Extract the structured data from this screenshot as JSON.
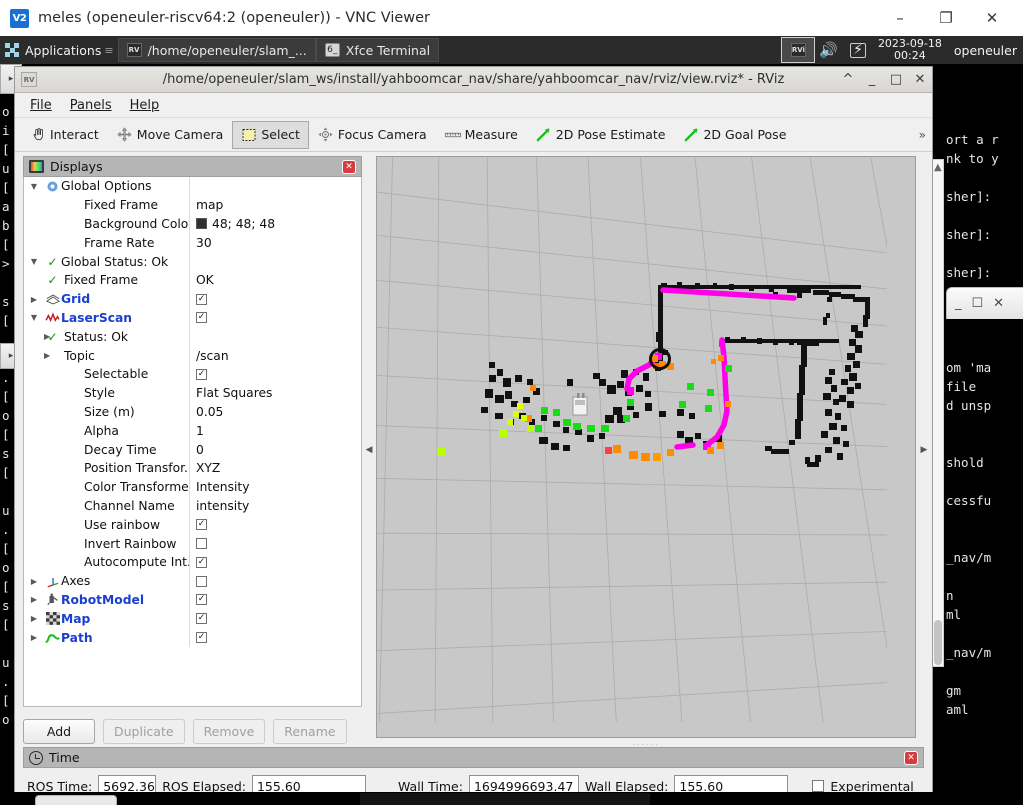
{
  "vnc": {
    "logo": "V2",
    "title": "meles (openeuler-riscv64:2 (openeuler)) - VNC Viewer",
    "minimize": "–",
    "maximize": "❐",
    "close": "✕"
  },
  "taskbar": {
    "applications_label": "Applications",
    "handle": "≡",
    "tasks": [
      {
        "icon": "rviz-icon",
        "label": "/home/openeuler/slam_..."
      },
      {
        "icon": "terminal-icon",
        "label": "Xfce Terminal"
      }
    ],
    "tray_window_icon": "RVi",
    "volume_icon": "volume-icon",
    "battery_icon": "battery-icon",
    "date": "2023-09-18",
    "time": "00:24",
    "user": "openeuler"
  },
  "terminals": {
    "left_text": ">\n\no\ni\n[\nu\n[\na\nb\n[\n>\n\ns\n[\n\nu\n.\n[\no\n[\ns\n[\n\nu\n.\n[\no\n[\ns\n[\n\nu\n.\n[\no",
    "right_text": "ort a r\nnk to y\n\nsher]:\n\nsher]:\n\nsher]:\n\n\n\n\nom 'ma\nfile\nd unsp\n\n\nshold\n\ncessfu\n\n\n_nav/m\n\nn\nml\n\n_nav/m\n\ngm\naml"
  },
  "rviz": {
    "window_icon": "rviz-icon",
    "title": "/home/openeuler/slam_ws/install/yahboomcar_nav/share/yahboomcar_nav/rviz/view.rviz* - RViz",
    "window_buttons": {
      "shade": "^",
      "minimize": "_",
      "maximize": "□",
      "close": "✕"
    },
    "menu": [
      "File",
      "Panels",
      "Help"
    ],
    "toolbar": {
      "items": [
        {
          "label": "Interact",
          "icon": "hand-cursor-icon",
          "active": false
        },
        {
          "label": "Move Camera",
          "icon": "move-camera-icon",
          "active": false
        },
        {
          "label": "Select",
          "icon": "select-rect-icon",
          "active": true
        },
        {
          "label": "Focus Camera",
          "icon": "focus-camera-icon",
          "active": false
        },
        {
          "label": "Measure",
          "icon": "ruler-icon",
          "active": false
        },
        {
          "label": "2D Pose Estimate",
          "icon": "pose-arrow-icon",
          "active": false
        },
        {
          "label": "2D Goal Pose",
          "icon": "goal-arrow-icon",
          "active": false
        }
      ],
      "overflow": "»"
    },
    "displays": {
      "panel_title": "Displays",
      "close_glyph": "✕",
      "rows": [
        {
          "id": "global-options",
          "arrow": "down",
          "icon": "gear-icon",
          "label": "Global Options",
          "label_style": "plain",
          "indent": 0,
          "value_type": "none",
          "value": ""
        },
        {
          "id": "fixed-frame",
          "arrow": "",
          "icon": "",
          "label": "Fixed Frame",
          "label_style": "plain",
          "indent": 1,
          "value_type": "text",
          "value": "map"
        },
        {
          "id": "background-color",
          "arrow": "",
          "icon": "",
          "label": "Background Color",
          "label_style": "plain",
          "indent": 1,
          "value_type": "color",
          "value": "48; 48; 48",
          "color": "#303030"
        },
        {
          "id": "frame-rate",
          "arrow": "",
          "icon": "",
          "label": "Frame Rate",
          "label_style": "plain",
          "indent": 1,
          "value_type": "text",
          "value": "30"
        },
        {
          "id": "global-status",
          "arrow": "down",
          "icon": "check-icon",
          "label": "Global Status: Ok",
          "label_style": "plain",
          "indent": 0,
          "value_type": "none",
          "value": ""
        },
        {
          "id": "status-fixed-frame",
          "arrow": "",
          "icon": "check-icon",
          "label": "Fixed Frame",
          "label_style": "plain",
          "indent": 1,
          "value_type": "text",
          "value": "OK"
        },
        {
          "id": "grid",
          "arrow": "right",
          "icon": "grid-icon",
          "label": "Grid",
          "label_style": "blue",
          "indent": 0,
          "value_type": "checkbox",
          "value": "checked"
        },
        {
          "id": "laserscan",
          "arrow": "down",
          "icon": "laserscan-icon",
          "label": "LaserScan",
          "label_style": "blue",
          "indent": 0,
          "value_type": "checkbox",
          "value": "checked"
        },
        {
          "id": "laserscan-status",
          "arrow": "right-ind",
          "icon": "check-icon",
          "label": "Status: Ok",
          "label_style": "plain",
          "indent": 1,
          "value_type": "none",
          "value": ""
        },
        {
          "id": "laserscan-topic",
          "arrow": "right-ind",
          "icon": "",
          "label": "Topic",
          "label_style": "plain",
          "indent": 1,
          "value_type": "text",
          "value": "/scan"
        },
        {
          "id": "laserscan-selectable",
          "arrow": "",
          "icon": "",
          "label": "Selectable",
          "label_style": "plain",
          "indent": 1,
          "value_type": "checkbox",
          "value": "checked"
        },
        {
          "id": "laserscan-style",
          "arrow": "",
          "icon": "",
          "label": "Style",
          "label_style": "plain",
          "indent": 1,
          "value_type": "text",
          "value": "Flat Squares"
        },
        {
          "id": "laserscan-size",
          "arrow": "",
          "icon": "",
          "label": "Size (m)",
          "label_style": "plain",
          "indent": 1,
          "value_type": "text",
          "value": "0.05"
        },
        {
          "id": "laserscan-alpha",
          "arrow": "",
          "icon": "",
          "label": "Alpha",
          "label_style": "plain",
          "indent": 1,
          "value_type": "text",
          "value": "1"
        },
        {
          "id": "laserscan-decay-time",
          "arrow": "",
          "icon": "",
          "label": "Decay Time",
          "label_style": "plain",
          "indent": 1,
          "value_type": "text",
          "value": "0"
        },
        {
          "id": "laserscan-position-transformer",
          "arrow": "",
          "icon": "",
          "label": "Position Transfor...",
          "label_style": "plain",
          "indent": 1,
          "value_type": "text",
          "value": "XYZ"
        },
        {
          "id": "laserscan-color-transformer",
          "arrow": "",
          "icon": "",
          "label": "Color Transformer",
          "label_style": "plain",
          "indent": 1,
          "value_type": "text",
          "value": "Intensity"
        },
        {
          "id": "laserscan-channel-name",
          "arrow": "",
          "icon": "",
          "label": "Channel Name",
          "label_style": "plain",
          "indent": 1,
          "value_type": "text",
          "value": "intensity"
        },
        {
          "id": "laserscan-use-rainbow",
          "arrow": "",
          "icon": "",
          "label": "Use rainbow",
          "label_style": "plain",
          "indent": 1,
          "value_type": "checkbox",
          "value": "checked"
        },
        {
          "id": "laserscan-invert-rainbow",
          "arrow": "",
          "icon": "",
          "label": "Invert Rainbow",
          "label_style": "plain",
          "indent": 1,
          "value_type": "checkbox",
          "value": "unchecked"
        },
        {
          "id": "laserscan-autocompute-intensity",
          "arrow": "",
          "icon": "",
          "label": "Autocompute Int...",
          "label_style": "plain",
          "indent": 1,
          "value_type": "checkbox",
          "value": "checked"
        },
        {
          "id": "axes",
          "arrow": "right",
          "icon": "axes-icon",
          "label": "Axes",
          "label_style": "plain",
          "indent": 0,
          "value_type": "checkbox",
          "value": "unchecked"
        },
        {
          "id": "robotmodel",
          "arrow": "right",
          "icon": "robot-icon",
          "label": "RobotModel",
          "label_style": "blue",
          "indent": 0,
          "value_type": "checkbox",
          "value": "checked"
        },
        {
          "id": "map",
          "arrow": "right",
          "icon": "map-icon",
          "label": "Map",
          "label_style": "blue",
          "indent": 0,
          "value_type": "checkbox",
          "value": "checked"
        },
        {
          "id": "path",
          "arrow": "right",
          "icon": "path-icon",
          "label": "Path",
          "label_style": "blue",
          "indent": 0,
          "value_type": "checkbox",
          "value": "checked"
        }
      ],
      "buttons": [
        {
          "label": "Add",
          "disabled": false
        },
        {
          "label": "Duplicate",
          "disabled": true
        },
        {
          "label": "Remove",
          "disabled": true
        },
        {
          "label": "Rename",
          "disabled": true
        }
      ]
    },
    "time_panel": {
      "panel_title": "Time",
      "close_glyph": "✕",
      "ros_time_label": "ROS Time:",
      "ros_time_value": "5692.36",
      "ros_elapsed_label": "ROS Elapsed:",
      "ros_elapsed_value": "155.60",
      "wall_time_label": "Wall Time:",
      "wall_time_value": "1694996693.47",
      "wall_elapsed_label": "Wall Elapsed:",
      "wall_elapsed_value": "155.60",
      "experimental_label": "Experimental",
      "experimental_checked": false
    },
    "render_view": {
      "background_color": "#c8c8c8",
      "grid_color": "#a8a8a8",
      "occupancy_color": "#000000",
      "path_color": "#ff00ff",
      "scan_colors": [
        "#ff8c00",
        "#00d000",
        "#c8ff00",
        "#ffff00"
      ],
      "robot_color": "#ffffff"
    },
    "collapse_left_glyph": "◀",
    "collapse_right_glyph": "▶"
  }
}
